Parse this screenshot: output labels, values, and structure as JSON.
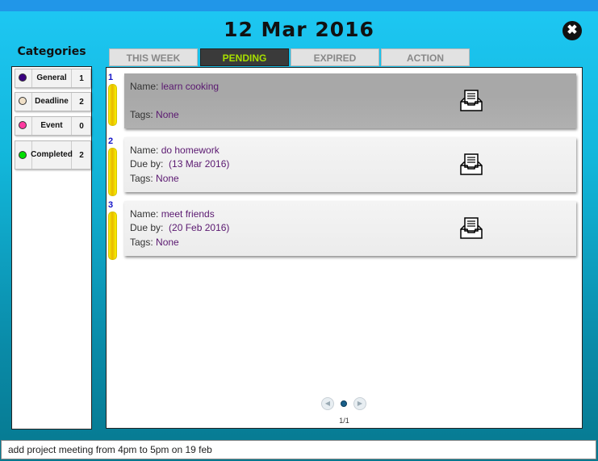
{
  "header": {
    "date": "12 Mar 2016",
    "close_icon": "close-icon"
  },
  "categories": {
    "title": "Categories",
    "items": [
      {
        "label": "General",
        "count": "1",
        "color": "#3a0080"
      },
      {
        "label": "Deadline",
        "count": "2",
        "color": "#f0e0c8"
      },
      {
        "label": "Event",
        "count": "0",
        "color": "#ff3aa0"
      },
      {
        "label": "Completed",
        "count": "2",
        "color": "#00dd00"
      }
    ]
  },
  "tabs": [
    {
      "label": "THIS WEEK",
      "active": false
    },
    {
      "label": "PENDING",
      "active": true
    },
    {
      "label": "EXPIRED",
      "active": false
    },
    {
      "label": "ACTION",
      "active": false
    }
  ],
  "tasks": [
    {
      "index": "1",
      "name_label": "Name:",
      "name": "learn cooking",
      "tags_label": "Tags:",
      "tags": "None",
      "selected": true
    },
    {
      "index": "2",
      "name_label": "Name:",
      "name": "do homework",
      "due_label": "Due by:",
      "due": "(13 Mar 2016)",
      "tags_label": "Tags:",
      "tags": "None"
    },
    {
      "index": "3",
      "name_label": "Name:",
      "name": "meet friends",
      "due_label": "Due by:",
      "due": "(20 Feb 2016)",
      "tags_label": "Tags:",
      "tags": "None"
    }
  ],
  "pagination": {
    "page_count": "1/1"
  },
  "command": {
    "value": "add project meeting from 4pm to 5pm on 19 feb"
  }
}
